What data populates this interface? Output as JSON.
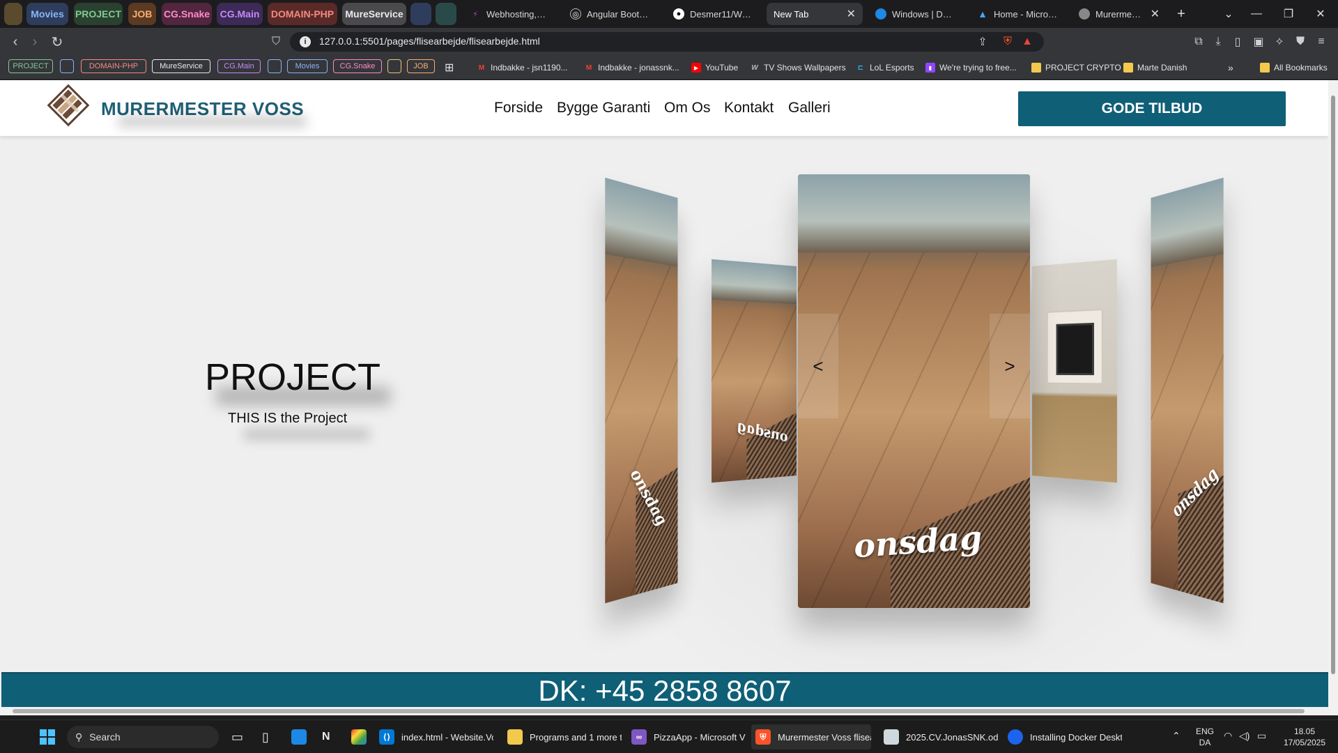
{
  "browser": {
    "tab_groups": [
      {
        "label": "",
        "bg": "#5a4a2e",
        "fg": "#f0c674"
      },
      {
        "label": "Movies",
        "bg": "#2e3d5c",
        "fg": "#8ab4f8"
      },
      {
        "label": "PROJECT",
        "bg": "#29412e",
        "fg": "#81c995"
      },
      {
        "label": "JOB",
        "bg": "#5a3a22",
        "fg": "#fcad70"
      },
      {
        "label": "CG.Snake",
        "bg": "#52263f",
        "fg": "#ff8bcb"
      },
      {
        "label": "CG.Main",
        "bg": "#3d2a57",
        "fg": "#c58af9"
      },
      {
        "label": "DOMAIN-PHP",
        "bg": "#5a2a28",
        "fg": "#f28b82"
      },
      {
        "label": "MureService",
        "bg": "#4a4a4d",
        "fg": "#e8eaed"
      },
      {
        "label": "",
        "bg": "#2e3d5c",
        "fg": "#8ab4f8"
      },
      {
        "label": "",
        "bg": "#2a4a4a",
        "fg": "#78d9ec"
      }
    ],
    "tabs": [
      {
        "label": "Webhosting, Wor",
        "icon": "webhosting-icon",
        "color": "#9c27b0",
        "active": false
      },
      {
        "label": "Angular Bootstrap",
        "icon": "angular-icon",
        "color": "#777777",
        "active": false
      },
      {
        "label": "Desmer11/Websit",
        "icon": "github-icon",
        "color": "#333333",
        "active": false
      },
      {
        "label": "New Tab",
        "icon": "",
        "color": "",
        "active": true
      },
      {
        "label": "Windows | Docker",
        "icon": "edge-icon",
        "color": "#1e88e5",
        "active": false
      },
      {
        "label": "Home - Microsoft",
        "icon": "azure-icon",
        "color": "#1976d2",
        "active": false
      },
      {
        "label": "Murermester",
        "icon": "globe-icon",
        "color": "#888888",
        "active": false
      }
    ],
    "new_tab_symbol": "+",
    "url": "127.0.0.1:5501/pages/flisearbejde/flisearbejde.html",
    "bookmark_groups": [
      {
        "label": "PROJECT",
        "color": "#81c995"
      },
      {
        "label": "",
        "color": "#8ab4f8"
      },
      {
        "label": "DOMAIN-PHP",
        "color": "#f28b82"
      },
      {
        "label": "MureService",
        "color": "#e8eaed"
      },
      {
        "label": "CG.Main",
        "color": "#c58af9"
      },
      {
        "label": "",
        "color": "#8ab4f8"
      },
      {
        "label": "Movies",
        "color": "#8ab4f8"
      },
      {
        "label": "CG.Snake",
        "color": "#ff8bcb"
      },
      {
        "label": "",
        "color": "#f0c674"
      },
      {
        "label": "JOB",
        "color": "#fcad70"
      }
    ],
    "bookmarks": [
      {
        "label": "Indbakke - jsn1190...",
        "icon": "gmail-icon",
        "color": "#ea4335"
      },
      {
        "label": "Indbakke - jonassnk...",
        "icon": "gmail-icon",
        "color": "#ea4335"
      },
      {
        "label": "YouTube",
        "icon": "youtube-icon",
        "color": "#ff0000"
      },
      {
        "label": "TV Shows Wallpapers",
        "icon": "wallpaper-icon",
        "color": "#bbbbbb"
      },
      {
        "label": "LoL Esports",
        "icon": "lol-icon",
        "color": "#29b6f6"
      },
      {
        "label": "We're trying to free...",
        "icon": "twitch-icon",
        "color": "#9146ff"
      },
      {
        "label": "PROJECT CRYPTO",
        "icon": "folder-icon",
        "color": "#f2c94c"
      },
      {
        "label": "Marte Danish",
        "icon": "folder-icon",
        "color": "#f2c94c"
      }
    ],
    "all_bookmarks": "All Bookmarks"
  },
  "site": {
    "brand": "MURERMESTER VOSS",
    "nav": [
      "Forside",
      "Bygge Garanti",
      "Om Os",
      "Kontakt",
      "Galleri"
    ],
    "cta": "GODE TILBUD",
    "hero_title": "PROJECT",
    "hero_subtitle": "THIS IS the Project",
    "slide_caption": "onsdag",
    "prev_label": "<",
    "next_label": ">",
    "phone": "DK: +45 2858 8607",
    "brand_color": "#1f6076",
    "accent_color": "#0f5f77"
  },
  "taskbar": {
    "search_placeholder": "Search",
    "apps": [
      {
        "label": "index.html - Website.Vo",
        "icon": "vscode-icon",
        "color": "#0078d4"
      },
      {
        "label": "Programs and 1 more ta",
        "icon": "folder-icon",
        "color": "#f2c94c"
      },
      {
        "label": "PizzaApp - Microsoft Vi",
        "icon": "visual-studio-icon",
        "color": "#7e57c2"
      },
      {
        "label": "Murermester Voss flisea",
        "icon": "brave-icon",
        "color": "#fb542b"
      },
      {
        "label": "2025.CV.JonasSNK.odt -",
        "icon": "document-icon",
        "color": "#cfd8dc"
      },
      {
        "label": "Installing Docker Deskt",
        "icon": "docker-icon",
        "color": "#1d63ed"
      }
    ],
    "lang_top": "ENG",
    "lang_bottom": "DA",
    "time": "18.05",
    "date": "17/05/2025"
  }
}
